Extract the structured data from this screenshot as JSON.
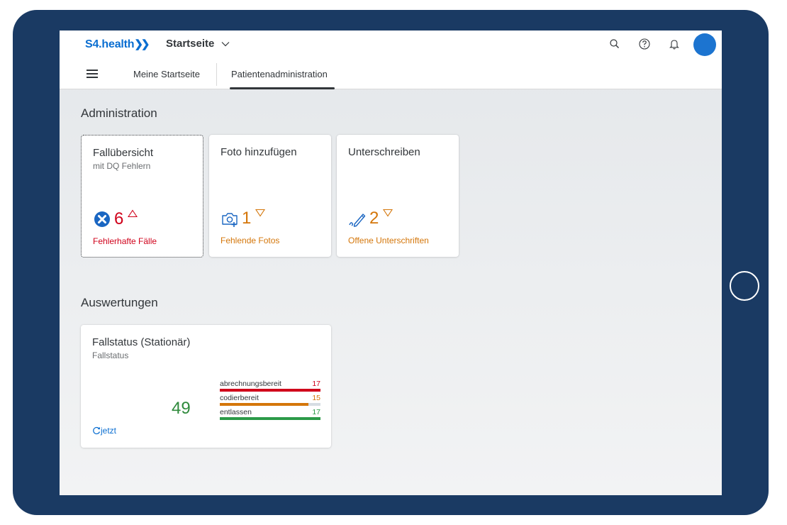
{
  "header": {
    "logo_text": "S4.health",
    "logo_chevrons": "❯❯",
    "title": "Startseite",
    "icons": [
      "search-icon",
      "help-icon",
      "notification-bell-icon",
      "user-avatar"
    ]
  },
  "nav": {
    "tabs": [
      {
        "label": "Meine Startseite",
        "selected": false
      },
      {
        "label": "Patientenadministration",
        "selected": true
      }
    ]
  },
  "sections": {
    "administration": {
      "title": "Administration",
      "tiles": [
        {
          "title": "Fallübersicht",
          "subtitle": "mit DQ Fehlern",
          "value": "6",
          "indicator": "up",
          "icon": "error-circle-icon",
          "footer": "Fehlerhafte Fälle",
          "color": "#d0021b"
        },
        {
          "title": "Foto hinzufügen",
          "value": "1",
          "indicator": "down",
          "icon": "add-photo-icon",
          "footer": "Fehlende Fotos",
          "color": "#d4760a"
        },
        {
          "title": "Unterschreiben",
          "value": "2",
          "indicator": "down",
          "icon": "signature-icon",
          "footer": "Offene Unterschriften",
          "color": "#d4760a"
        }
      ]
    },
    "auswertungen": {
      "title": "Auswertungen",
      "tile": {
        "title": "Fallstatus (Stationär)",
        "subtitle": "Fallstatus",
        "total": "49",
        "refresh_label": "jetzt",
        "bars": [
          {
            "label": "abrechnungsbereit",
            "value": 17,
            "color": "#d0021b"
          },
          {
            "label": "codierbereit",
            "value": 15,
            "color": "#d4760a"
          },
          {
            "label": "entlassen",
            "value": 17,
            "color": "#2b9a48"
          }
        ]
      }
    }
  },
  "colors": {
    "brand": "#0a6ed1",
    "device_frame": "#1a3a63",
    "error": "#d0021b",
    "warning": "#d4760a",
    "success": "#2b9a48"
  }
}
